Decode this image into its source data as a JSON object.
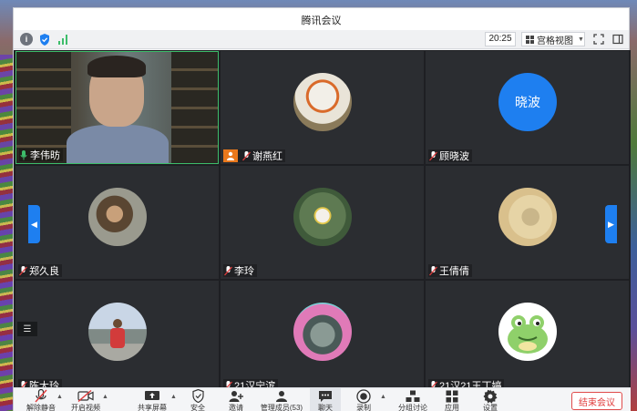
{
  "window": {
    "title": "腾讯会议"
  },
  "toolbar": {
    "timer": "20:25",
    "layout_label": "宫格视图"
  },
  "participants": [
    {
      "name": "李伟昉",
      "type": "camera",
      "speaking": true
    },
    {
      "name": "谢燕红",
      "type": "avatar",
      "host": true
    },
    {
      "name": "顾晓波",
      "type": "text-avatar",
      "avatar_text": "晓波"
    },
    {
      "name": "郑久良",
      "type": "avatar"
    },
    {
      "name": "李玲",
      "type": "avatar"
    },
    {
      "name": "王倩倩",
      "type": "avatar"
    },
    {
      "name": "陈大玲",
      "type": "avatar"
    },
    {
      "name": "21汉宁滨",
      "type": "avatar"
    },
    {
      "name": "21汉21王丁婷",
      "type": "avatar"
    }
  ],
  "controls": [
    {
      "label": "解除静音",
      "icon": "mic-muted-icon"
    },
    {
      "label": "开启视频",
      "icon": "camera-off-icon"
    },
    {
      "label": "共享屏幕",
      "icon": "share-screen-icon"
    },
    {
      "label": "安全",
      "icon": "shield-icon"
    },
    {
      "label": "邀请",
      "icon": "invite-icon"
    },
    {
      "label": "管理成员(53)",
      "icon": "members-icon"
    },
    {
      "label": "聊天",
      "icon": "chat-icon"
    },
    {
      "label": "录制",
      "icon": "record-icon"
    },
    {
      "label": "分组讨论",
      "icon": "breakout-icon"
    },
    {
      "label": "应用",
      "icon": "apps-icon"
    },
    {
      "label": "设置",
      "icon": "settings-icon"
    }
  ],
  "end_button": "结束会议",
  "colors": {
    "accent": "#1e7ff0",
    "host_badge": "#e9781c",
    "end": "#e03b3b",
    "speaking": "#3dbd6a"
  }
}
